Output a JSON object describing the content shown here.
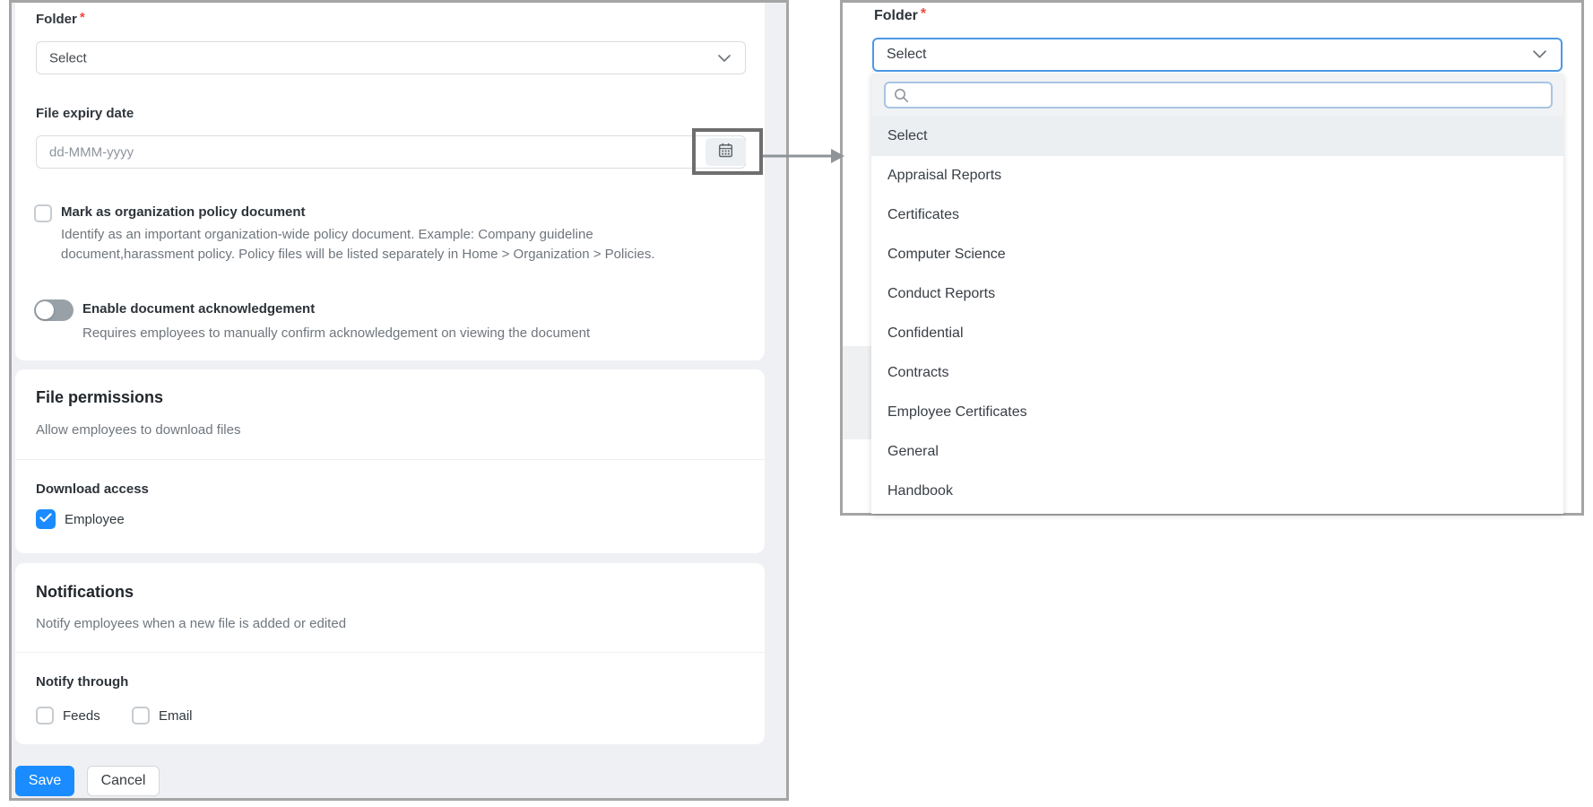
{
  "left_panel": {
    "folder_field": {
      "label": "Folder",
      "required": "*",
      "value": "Select"
    },
    "expiry_field": {
      "label": "File expiry date",
      "placeholder": "dd-MMM-yyyy"
    },
    "policy_checkbox": {
      "label": "Mark as organization policy document",
      "checked": false,
      "description": "Identify as an important organization-wide policy document. Example: Company guideline document,harassment policy. Policy files will be listed separately in Home > Organization > Policies."
    },
    "acknowledgement_toggle": {
      "label": "Enable document acknowledgement",
      "enabled": false,
      "description": "Requires employees to manually confirm acknowledgement on viewing the document"
    },
    "file_permissions": {
      "title": "File permissions",
      "subtitle": "Allow employees to download files",
      "download_access_label": "Download access",
      "employee_option": {
        "label": "Employee",
        "checked": true
      }
    },
    "notifications": {
      "title": "Notifications",
      "subtitle": "Notify employees when a new file is added or edited",
      "notify_through_label": "Notify through",
      "feeds_option": {
        "label": "Feeds",
        "checked": false
      },
      "email_option": {
        "label": "Email",
        "checked": false
      }
    },
    "actions": {
      "save": "Save",
      "cancel": "Cancel"
    }
  },
  "right_panel": {
    "folder_field": {
      "label": "Folder",
      "required": "*",
      "value": "Select"
    },
    "search_placeholder": "",
    "dropdown": {
      "selected": "Select",
      "options": [
        "Select",
        "Appraisal Reports",
        "Certificates",
        "Computer Science",
        "Conduct Reports",
        "Confidential",
        "Contracts",
        "Employee Certificates",
        "General",
        "Handbook"
      ]
    }
  },
  "colors": {
    "accent_blue": "#1a8cff",
    "focus_border_blue": "#4c99e8",
    "frame_border_gray": "#a5a5a5",
    "required_red": "#ef4a3c",
    "page_background": "#eef0f3"
  }
}
